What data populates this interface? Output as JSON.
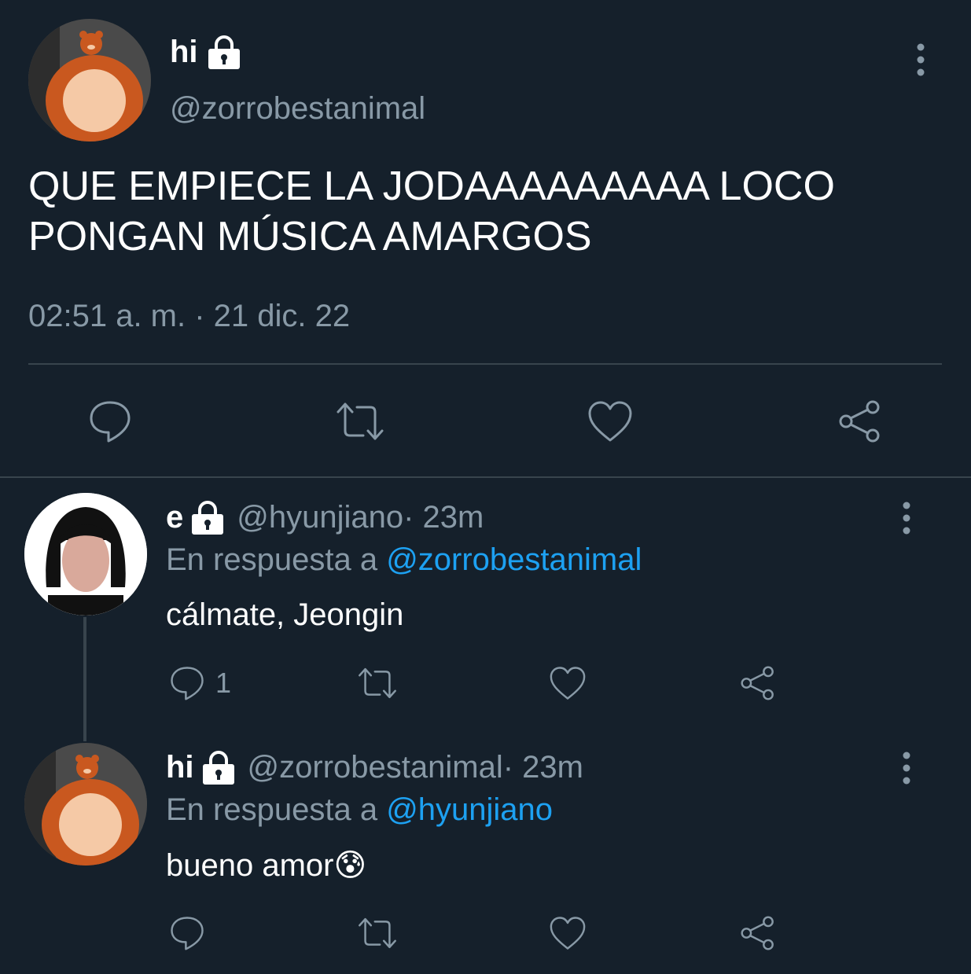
{
  "main_tweet": {
    "author": {
      "name": "hi",
      "handle": "@zorrobestanimal",
      "avatar": "teddy-bear-avatar",
      "locked_icon": "lock-icon"
    },
    "text_line1": "QUE EMPIECE LA JODAAAAAAAAA LOCO",
    "text_line2": "PONGAN MÚSICA AMARGOS",
    "timestamp": "02:51 a. m. · 21 dic. 22",
    "actions": [
      "reply-icon",
      "retweet-icon",
      "like-icon",
      "share-icon"
    ],
    "more_icon": "more-vertical-icon"
  },
  "replies": [
    {
      "name": "e",
      "handle": "@hyunjiano",
      "time": " · 23m",
      "reply_prefix": "En respuesta a ",
      "reply_to": "@zorrobestanimal",
      "text": "cálmate, Jeongin",
      "reply_count": "1",
      "avatar": "long-hair-man-avatar"
    },
    {
      "name": "hi",
      "handle": "@zorrobestanimal",
      "time": " · 23m",
      "reply_prefix": "En respuesta a ",
      "reply_to": "@hyunjiano",
      "text": "bueno amor",
      "emoji": "😰",
      "avatar": "teddy-bear-avatar"
    }
  ],
  "colors": {
    "background": "#15202b",
    "muted": "#8899a6",
    "link": "#1da1f2",
    "divider": "#38444d"
  }
}
